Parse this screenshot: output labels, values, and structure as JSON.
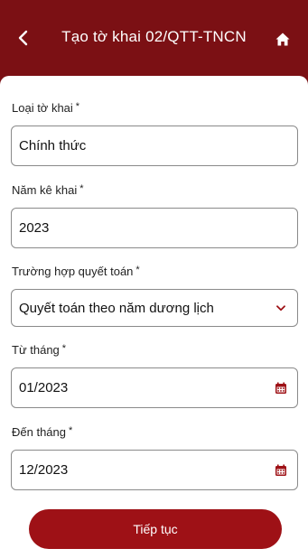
{
  "header": {
    "title": "Tạo tờ khai 02/QTT-TNCN",
    "back_icon": "chevron-left-icon",
    "home_icon": "home-icon",
    "background": "#7b1014"
  },
  "form": {
    "required_mark": "*",
    "loai_to_khai": {
      "label": "Loại tờ khai",
      "value": "Chính thức"
    },
    "nam_ke_khai": {
      "label": "Năm kê khai",
      "value": "2023"
    },
    "truong_hop": {
      "label": "Trường hợp quyết toán",
      "value": "Quyết toán theo năm dương lịch",
      "icon": "chevron-down-icon"
    },
    "tu_thang": {
      "label": "Từ tháng",
      "value": "01/2023",
      "icon": "calendar-icon"
    },
    "den_thang": {
      "label": "Đến tháng",
      "value": "12/2023",
      "icon": "calendar-icon"
    }
  },
  "submit": {
    "label": "Tiếp tục",
    "color": "#9e1116"
  }
}
